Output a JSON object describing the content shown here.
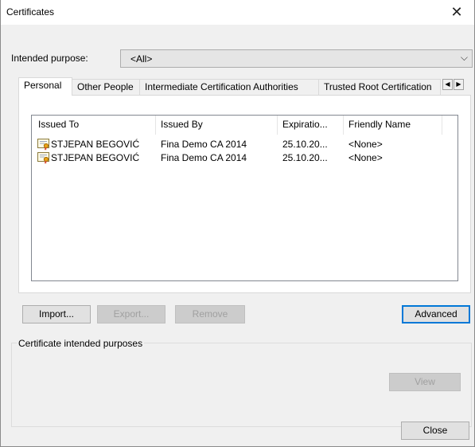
{
  "window": {
    "title": "Certificates",
    "close_glyph": "✕"
  },
  "intended_purpose": {
    "label": "Intended purpose:",
    "value": "<All>",
    "arrow": "⌵"
  },
  "tabs": [
    {
      "label": "Personal",
      "active": true
    },
    {
      "label": "Other People",
      "active": false
    },
    {
      "label": "Intermediate Certification Authorities",
      "active": false
    },
    {
      "label": "Trusted Root Certification",
      "active": false
    }
  ],
  "tab_scroll": {
    "left": "◀",
    "right": "▶"
  },
  "list": {
    "columns": [
      "Issued To",
      "Issued By",
      "Expiratio...",
      "Friendly Name"
    ],
    "rows": [
      {
        "issued_to": "STJEPAN BEGOVIĆ",
        "issued_by": "Fina Demo CA 2014",
        "expiration": "25.10.20...",
        "friendly_name": "<None>",
        "icon": "certificate-icon"
      },
      {
        "issued_to": "STJEPAN BEGOVIĆ",
        "issued_by": "Fina Demo CA 2014",
        "expiration": "25.10.20...",
        "friendly_name": "<None>",
        "icon": "certificate-icon"
      }
    ]
  },
  "buttons": {
    "import": "Import...",
    "export": "Export...",
    "remove": "Remove",
    "advanced": "Advanced",
    "view": "View",
    "close": "Close"
  },
  "purposes_group": {
    "label": "Certificate intended purposes"
  },
  "colors": {
    "accent": "#0078d7",
    "dialog_bg": "#f0f0f0"
  }
}
